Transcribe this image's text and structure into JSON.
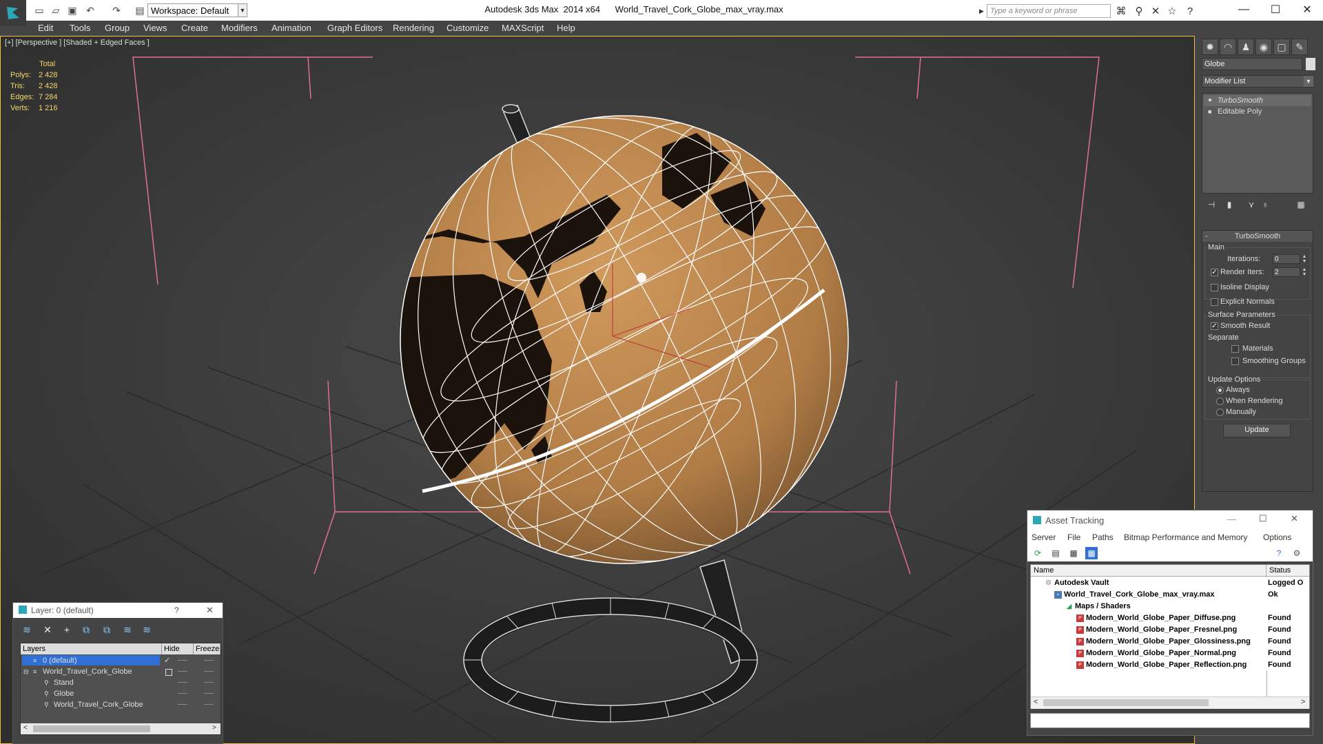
{
  "titlebar": {
    "workspace": "Workspace: Default",
    "title": "Autodesk 3ds Max  2014 x64      World_Travel_Cork_Globe_max_vray.max",
    "search_placeholder": "Type a keyword or phrase"
  },
  "menu": [
    "Edit",
    "Tools",
    "Group",
    "Views",
    "Create",
    "Modifiers",
    "Animation",
    "Graph Editors",
    "Rendering",
    "Customize",
    "MAXScript",
    "Help"
  ],
  "viewport": {
    "label": "[+] [Perspective ] [Shaded + Edged Faces ]",
    "stats": {
      "header": "Total",
      "rows": [
        {
          "label": "Polys:",
          "value": "2 428"
        },
        {
          "label": "Tris:",
          "value": "2 428"
        },
        {
          "label": "Edges:",
          "value": "7 284"
        },
        {
          "label": "Verts:",
          "value": "1 216"
        }
      ]
    }
  },
  "command_panel": {
    "object_name": "Globe",
    "modifier_list": "Modifier List",
    "stack": [
      "TurboSmooth",
      "Editable Poly"
    ],
    "turbosmooth": {
      "title": "TurboSmooth",
      "main": "Main",
      "iterations_label": "Iterations:",
      "iterations_value": "0",
      "render_iters_label": "Render Iters:",
      "render_iters_value": "2",
      "isoline": "Isoline Display",
      "explicit_normals": "Explicit Normals",
      "surface_params": "Surface Parameters",
      "smooth_result": "Smooth Result",
      "separate": "Separate",
      "materials": "Materials",
      "smoothing_groups": "Smoothing Groups",
      "update_options": "Update Options",
      "always": "Always",
      "when_rendering": "When Rendering",
      "manually": "Manually",
      "update_btn": "Update"
    }
  },
  "layer_dialog": {
    "title": "Layer: 0 (default)",
    "help": "?",
    "columns": [
      "Layers",
      "Hide",
      "Freeze"
    ],
    "rows": [
      {
        "name": "0 (default)",
        "selected": true
      },
      {
        "name": "World_Travel_Cork_Globe",
        "selected": false
      },
      {
        "name": "Stand",
        "selected": false
      },
      {
        "name": "Globe",
        "selected": false
      },
      {
        "name": "World_Travel_Cork_Globe",
        "selected": false
      }
    ]
  },
  "asset_dialog": {
    "title": "Asset Tracking",
    "menu": [
      "Server",
      "File",
      "Paths",
      "Bitmap Performance and Memory",
      "Options"
    ],
    "columns": [
      "Name",
      "Status"
    ],
    "rows": [
      {
        "name": "Autodesk Vault",
        "status": "Logged O"
      },
      {
        "name": "World_Travel_Cork_Globe_max_vray.max",
        "status": "Ok"
      },
      {
        "name": "Maps / Shaders",
        "status": ""
      },
      {
        "name": "Modern_World_Globe_Paper_Diffuse.png",
        "status": "Found"
      },
      {
        "name": "Modern_World_Globe_Paper_Fresnel.png",
        "status": "Found"
      },
      {
        "name": "Modern_World_Globe_Paper_Glossiness.png",
        "status": "Found"
      },
      {
        "name": "Modern_World_Globe_Paper_Normal.png",
        "status": "Found"
      },
      {
        "name": "Modern_World_Globe_Paper_Reflection.png",
        "status": "Found"
      }
    ]
  },
  "colors": {
    "stats_text": "#f5d86b",
    "selection_blue": "#2f6fd6",
    "cork": "#b07c45",
    "wire_white": "#ffffff",
    "viewport_border": "#f0c040"
  }
}
